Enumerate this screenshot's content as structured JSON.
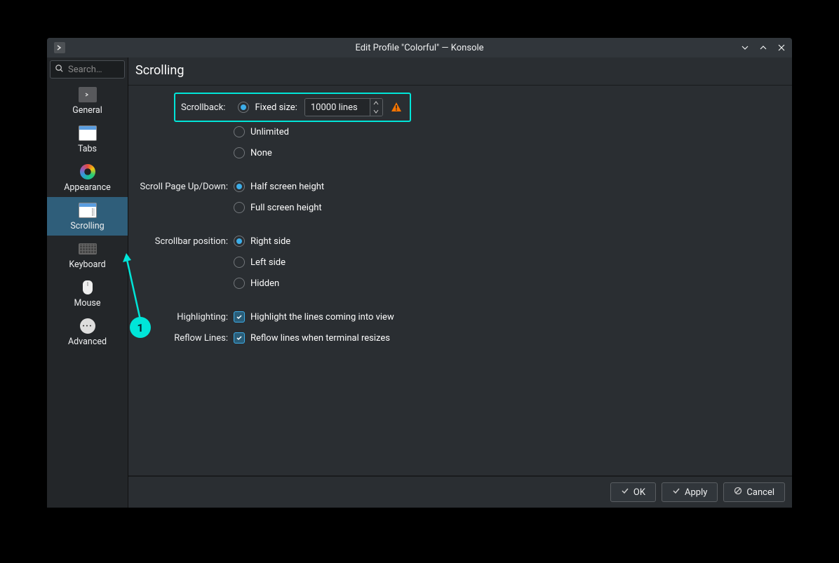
{
  "window": {
    "title": "Edit Profile \"Colorful\" — Konsole"
  },
  "search": {
    "placeholder": "Search…"
  },
  "sidebar": {
    "items": [
      {
        "label": "General"
      },
      {
        "label": "Tabs"
      },
      {
        "label": "Appearance"
      },
      {
        "label": "Scrolling"
      },
      {
        "label": "Keyboard"
      },
      {
        "label": "Mouse"
      },
      {
        "label": "Advanced"
      }
    ],
    "active_index": 3
  },
  "main": {
    "title": "Scrolling",
    "scrollback": {
      "label": "Scrollback:",
      "fixed_label": "Fixed size:",
      "fixed_value": "10000 lines",
      "unlimited_label": "Unlimited",
      "none_label": "None",
      "selected": "fixed"
    },
    "scroll_page": {
      "label": "Scroll Page Up/Down:",
      "half_label": "Half screen height",
      "full_label": "Full screen height",
      "selected": "half"
    },
    "scrollbar_pos": {
      "label": "Scrollbar position:",
      "right_label": "Right side",
      "left_label": "Left side",
      "hidden_label": "Hidden",
      "selected": "right"
    },
    "highlighting": {
      "label": "Highlighting:",
      "checkbox_label": "Highlight the lines coming into view",
      "checked": true
    },
    "reflow": {
      "label": "Reflow Lines:",
      "checkbox_label": "Reflow lines when terminal resizes",
      "checked": true
    }
  },
  "footer": {
    "ok": "OK",
    "apply": "Apply",
    "cancel": "Cancel"
  },
  "annotation": {
    "number": "1"
  }
}
